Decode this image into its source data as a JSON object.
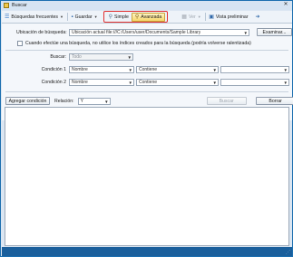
{
  "window": {
    "title": "Buscar"
  },
  "toolbar": {
    "frequent_label": "Búsquedas frecuentes",
    "save_label": "Guardar",
    "simple_label": "Simple",
    "advanced_label": "Avanzada",
    "view_label": "Ver",
    "preview_label": "Vista preliminar"
  },
  "search_location": {
    "label": "Ubicación de búsqueda:",
    "value": "Ubicación actual file:///C:/Users/user/Documents/Sample Library",
    "browse_label": "Examinar..."
  },
  "option_checkbox": {
    "label": "Cuando efectúe una búsqueda, no utilice los índices creados para la búsqueda (podría volverse ralentizada)"
  },
  "search_in": {
    "label": "Buscar:",
    "value": "Todo"
  },
  "conditions": [
    {
      "label": "Condición 1",
      "field": "Nombre",
      "operator": "Contiene",
      "value": ""
    },
    {
      "label": "Condición 2",
      "field": "Nombre",
      "operator": "Contiene",
      "value": ""
    }
  ],
  "actions": {
    "add_condition_label": "Agregar condición",
    "relation_label": "Relación:",
    "relation_value": "Y",
    "search_label": "Buscar",
    "clear_label": "Borrar"
  },
  "colors": {
    "window_border": "#1c6fb0",
    "status_bar": "#1a5f9c",
    "highlight_border": "#e23030",
    "active_tab": "#f6d86b"
  },
  "icons": {
    "app": "search-app-icon",
    "frequent": "star-list-icon",
    "save": "save-icon",
    "simple": "magnifier-icon",
    "advanced": "magnifier-plus-icon",
    "view": "view-grid-icon",
    "preview": "preview-pane-icon",
    "pin": "pin-icon"
  }
}
